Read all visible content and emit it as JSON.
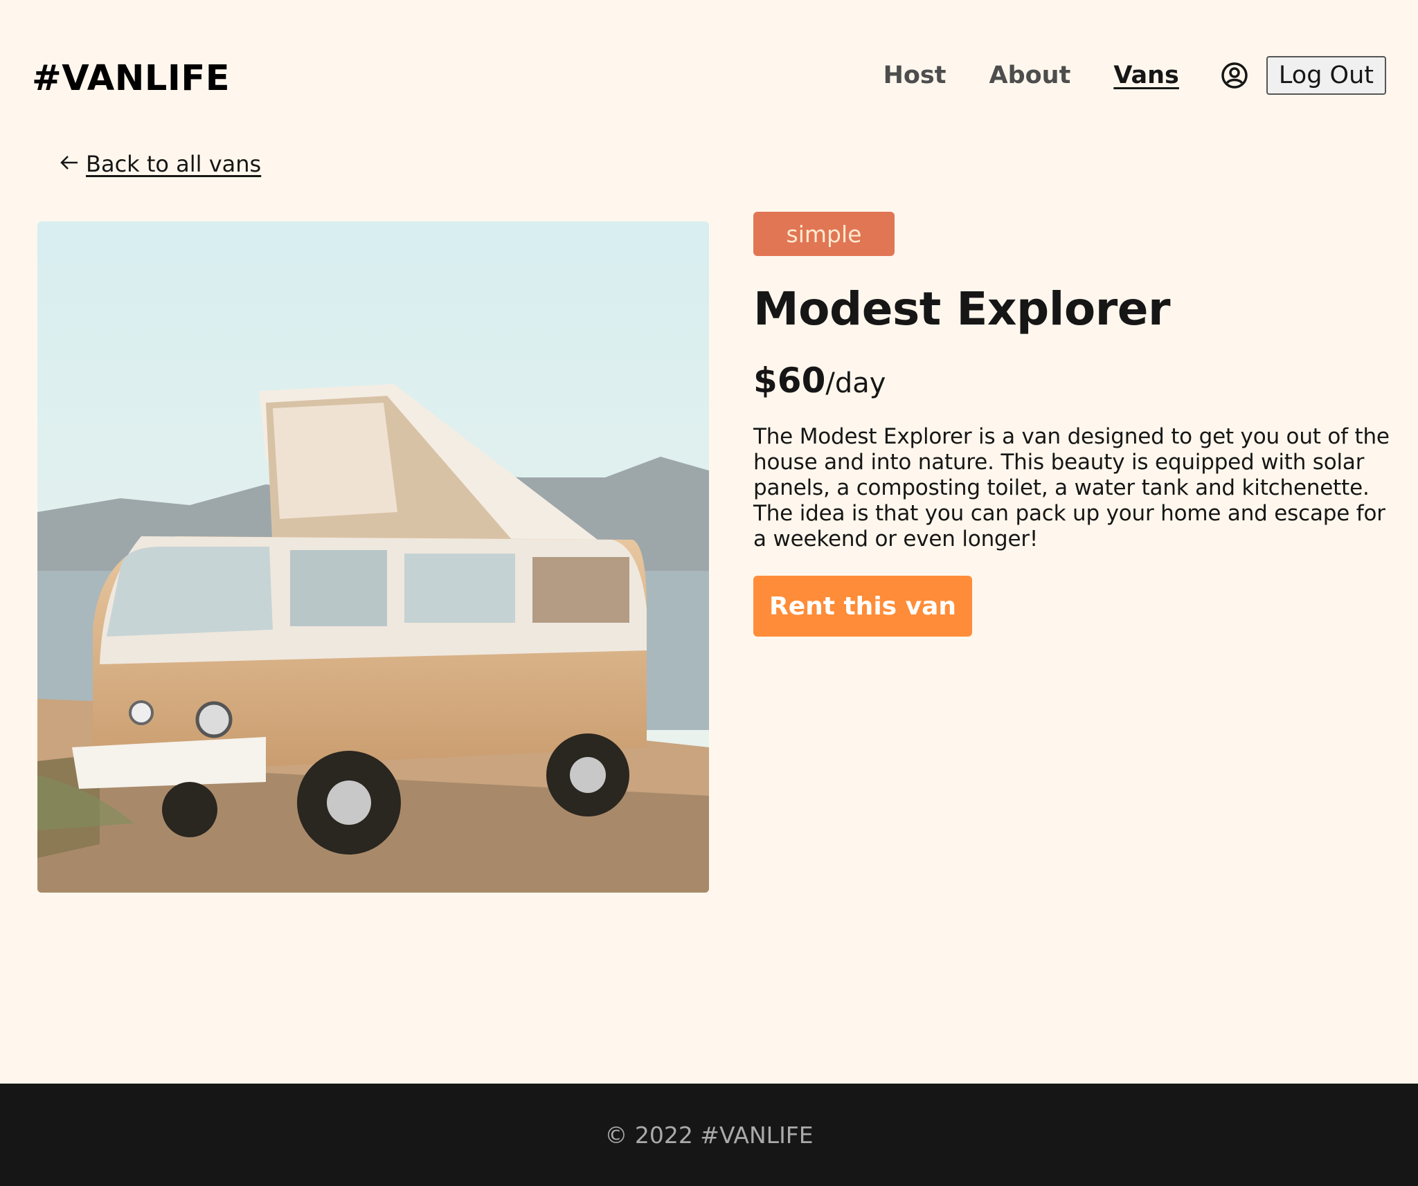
{
  "header": {
    "logo": "#VANLIFE",
    "nav": [
      {
        "label": "Host",
        "active": false
      },
      {
        "label": "About",
        "active": false
      },
      {
        "label": "Vans",
        "active": true
      }
    ],
    "user_icon": "user-circle-icon",
    "logout_label": "Log Out"
  },
  "back_link": {
    "icon": "arrow-left-icon",
    "label": "Back to all vans"
  },
  "van": {
    "type": "simple",
    "name": "Modest Explorer",
    "price": "$60",
    "price_unit": "/day",
    "description": "The Modest Explorer is a van designed to get you out of the house and into nature. This beauty is equipped with solar panels, a composting toilet, a water tank and kitchenette. The idea is that you can pack up your home and escape for a weekend or even longer!",
    "rent_label": "Rent this van"
  },
  "footer": {
    "text": "© 2022 #VANLIFE"
  },
  "colors": {
    "background": "#FFF7ED",
    "badge_simple": "#E17654",
    "rent_button": "#FF8C38",
    "footer_bg": "#161616"
  }
}
